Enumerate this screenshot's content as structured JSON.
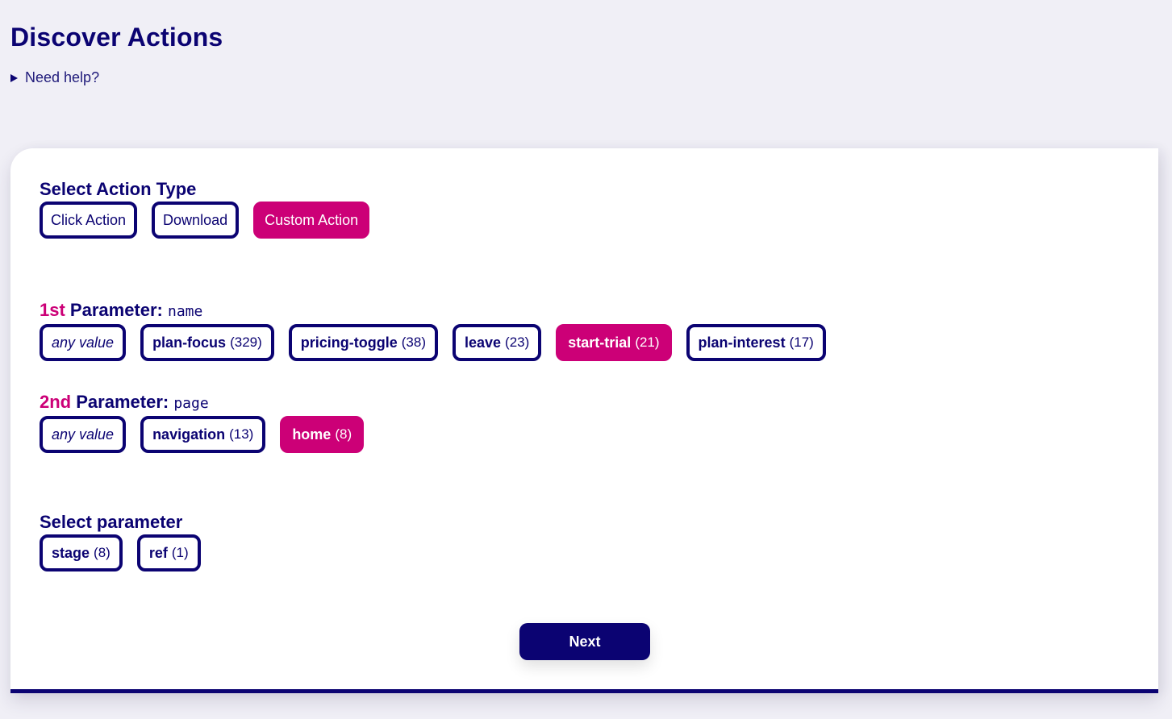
{
  "page": {
    "title": "Discover Actions",
    "help_label": "Need help?"
  },
  "action_type": {
    "title": "Select Action Type",
    "options": [
      {
        "label": "Click Action",
        "selected": false
      },
      {
        "label": "Download",
        "selected": false
      },
      {
        "label": "Custom Action",
        "selected": true
      }
    ]
  },
  "param1": {
    "ordinal": "1st",
    "title": "Parameter:",
    "name": "name",
    "any_value_label": "any value",
    "options": [
      {
        "label": "plan-focus",
        "count": "(329)",
        "selected": false
      },
      {
        "label": "pricing-toggle",
        "count": "(38)",
        "selected": false
      },
      {
        "label": "leave",
        "count": "(23)",
        "selected": false
      },
      {
        "label": "start-trial",
        "count": "(21)",
        "selected": true
      },
      {
        "label": "plan-interest",
        "count": "(17)",
        "selected": false
      }
    ]
  },
  "param2": {
    "ordinal": "2nd",
    "title": "Parameter:",
    "name": "page",
    "any_value_label": "any value",
    "options": [
      {
        "label": "navigation",
        "count": "(13)",
        "selected": false
      },
      {
        "label": "home",
        "count": "(8)",
        "selected": true
      }
    ]
  },
  "select_parameter": {
    "title": "Select parameter",
    "options": [
      {
        "label": "stage",
        "count": "(8)"
      },
      {
        "label": "ref",
        "count": "(1)"
      }
    ]
  },
  "next_label": "Next",
  "colors": {
    "primary": "#0b0372",
    "accent": "#cc0077",
    "background": "#f0eff6"
  }
}
